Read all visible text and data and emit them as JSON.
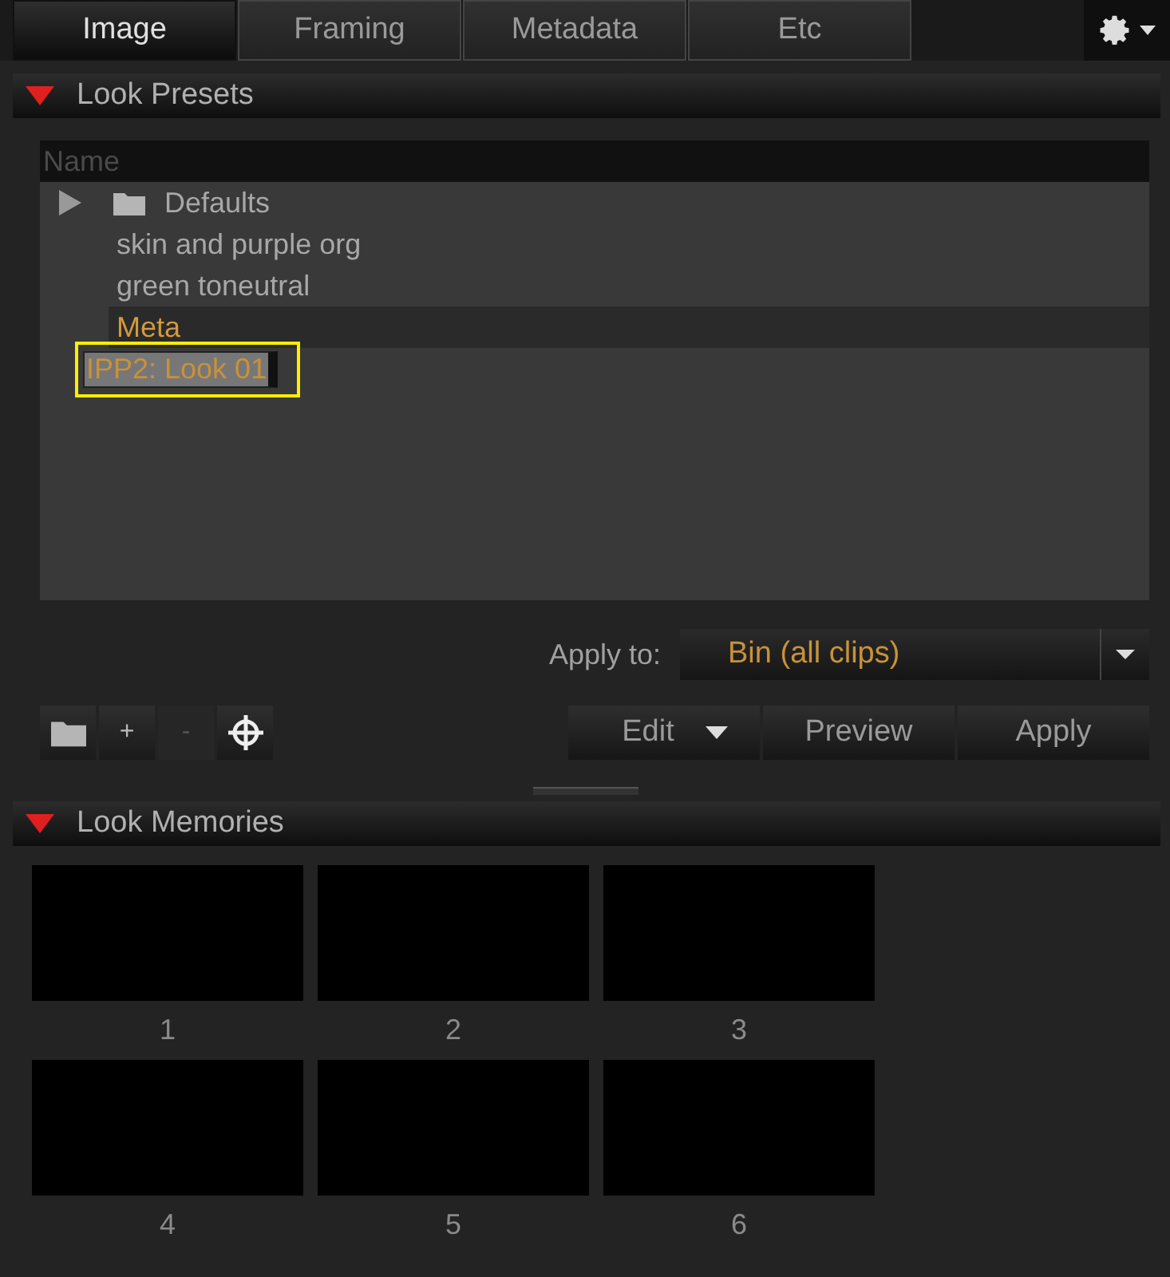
{
  "tabs": [
    {
      "label": "Image",
      "selected": true
    },
    {
      "label": "Framing",
      "selected": false
    },
    {
      "label": "Metadata",
      "selected": false
    },
    {
      "label": "Etc",
      "selected": false
    }
  ],
  "look_presets": {
    "title": "Look Presets",
    "expanded": true,
    "column": "Name",
    "items": [
      {
        "kind": "folder",
        "label": "Defaults",
        "expanded": false,
        "selected": false,
        "editing": false
      },
      {
        "kind": "preset",
        "label": "skin and purple org",
        "selected": false,
        "editing": false
      },
      {
        "kind": "preset",
        "label": "green toneutral",
        "selected": false,
        "editing": false
      },
      {
        "kind": "user",
        "label": "Meta",
        "selected": true,
        "editing": false
      },
      {
        "kind": "user",
        "label": "IPP2: Look 01",
        "selected": false,
        "editing": true
      }
    ],
    "apply_to_label": "Apply to:",
    "apply_to_value": "Bin (all clips)",
    "tools": [
      {
        "kind": "folder",
        "disabled": false
      },
      {
        "kind": "text",
        "label": "+",
        "disabled": false
      },
      {
        "kind": "text",
        "label": "-",
        "disabled": true
      },
      {
        "kind": "target",
        "disabled": false
      }
    ],
    "buttons": [
      {
        "label": "Edit",
        "kind": "menu"
      },
      {
        "label": "Preview",
        "kind": "plain"
      },
      {
        "label": "Apply",
        "kind": "plain"
      }
    ]
  },
  "look_memories": {
    "title": "Look Memories",
    "expanded": true,
    "slots": [
      "1",
      "2",
      "3",
      "4",
      "5",
      "6"
    ]
  }
}
